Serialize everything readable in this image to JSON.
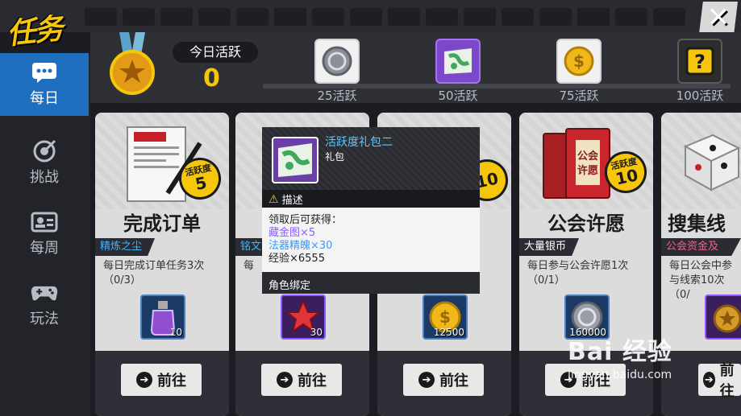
{
  "header": {
    "title": "任务",
    "close_label": "✕"
  },
  "sidebar": {
    "items": [
      {
        "label": "每日",
        "icon": "chat-icon",
        "active": true
      },
      {
        "label": "挑战",
        "icon": "target-icon",
        "active": false
      },
      {
        "label": "每周",
        "icon": "id-card-icon",
        "active": false
      },
      {
        "label": "玩法",
        "icon": "gamepad-icon",
        "active": false
      }
    ]
  },
  "activity": {
    "today_label": "今日活跃",
    "today_value": "0",
    "progress_fraction": 0,
    "milestones": [
      {
        "label": "25活跃",
        "icon": "silver-coin-icon"
      },
      {
        "label": "50活跃",
        "icon": "map-gift-icon"
      },
      {
        "label": "75活跃",
        "icon": "gold-coin-icon"
      },
      {
        "label": "100活跃",
        "icon": "mystery-box-icon"
      }
    ]
  },
  "cards": [
    {
      "name": "完成订单",
      "tag": "精炼之尘",
      "tag_color": "#3db6ff",
      "desc": "每日完成订单任务3次（0/3）",
      "reward_qty": "10",
      "badge_label": "活跃度",
      "badge_value": "5",
      "button": "前往",
      "reward_icon": "potion-icon"
    },
    {
      "name": "",
      "tag": "铭文",
      "tag_color": "#3db6ff",
      "desc": "每",
      "reward_qty": "30",
      "badge_label": "",
      "badge_value": "",
      "button": "前往",
      "reward_icon": "star-fragment-icon"
    },
    {
      "name": "",
      "tag": "",
      "tag_color": "#3db6ff",
      "desc": "",
      "reward_qty": "12500",
      "badge_label": "",
      "badge_value": "10",
      "button": "前往",
      "reward_icon": "gold-coin-icon"
    },
    {
      "name": "公会许愿",
      "tag": "大量银币",
      "tag_color": "#ffffff",
      "desc": "每日参与公会许愿1次（0/1）",
      "reward_qty": "160000",
      "badge_label": "活跃度",
      "badge_value": "10",
      "button": "前往",
      "reward_icon": "silver-coin-icon"
    },
    {
      "name": "搜集线",
      "tag": "公会资金及贡献",
      "tag_color": "#ff5a8a",
      "desc": "每日公会中参与线索10次（0/",
      "reward_qty": "",
      "badge_label": "",
      "badge_value": "",
      "button": "前往",
      "reward_icon": "medal-icon"
    }
  ],
  "popup": {
    "title": "活跃度礼包二",
    "subtitle": "礼包",
    "desc_label": "描述",
    "lines": [
      {
        "text": "领取后可获得：",
        "color": "#222222"
      },
      {
        "text": "藏金图×5",
        "color": "#8a5cff"
      },
      {
        "text": "法器精魄×30",
        "color": "#3a9bff"
      },
      {
        "text": "经验×6555",
        "color": "#222222"
      }
    ],
    "footer": "角色绑定"
  },
  "watermark": {
    "line1": "Bai 经验",
    "line2": "jingyan.baidu.com"
  }
}
